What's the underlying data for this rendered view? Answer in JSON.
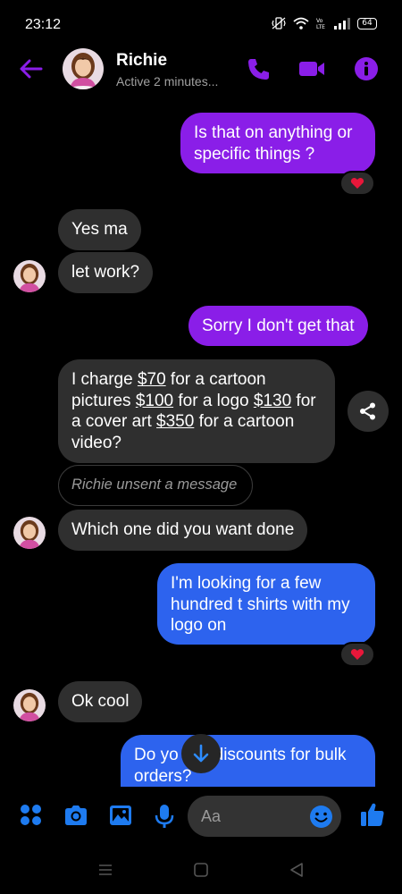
{
  "status_bar": {
    "time": "23:12",
    "battery": "64"
  },
  "header": {
    "name": "Richie",
    "status": "Active 2 minutes..."
  },
  "messages": [
    {
      "id": "m1",
      "side": "out",
      "text": "Is that on anything or specific things ?",
      "reaction": "heart"
    },
    {
      "id": "m2",
      "side": "in",
      "text": "Yes ma"
    },
    {
      "id": "m3",
      "side": "in",
      "text": "let work?"
    },
    {
      "id": "m4",
      "side": "out",
      "text": "Sorry I don't get that"
    },
    {
      "id": "m5",
      "side": "in",
      "segments": [
        "I charge ",
        "$70",
        " for a cartoon pictures ",
        "$100",
        " for a logo ",
        "$130",
        " for a cover art ",
        "$350",
        " for a cartoon video?"
      ]
    },
    {
      "id": "m6",
      "side": "in",
      "text": "Richie unsent a message"
    },
    {
      "id": "m7",
      "side": "in",
      "text": "Which one did you want done"
    },
    {
      "id": "m8",
      "side": "out",
      "text": "I'm looking for a few hundred t shirts with my logo on",
      "reaction": "heart"
    },
    {
      "id": "m9",
      "side": "in",
      "text": "Ok cool"
    },
    {
      "id": "m10",
      "side": "out",
      "text_before": "Do yo",
      "text_after": "discounts for bulk orders?"
    }
  ],
  "composer": {
    "placeholder": "Aa"
  },
  "icons": {
    "back": "arrow-left-icon",
    "call": "phone-icon",
    "video": "video-camera-icon",
    "info": "info-icon",
    "apps": "four-dots-icon",
    "camera": "camera-icon",
    "gallery": "image-icon",
    "mic": "microphone-icon",
    "emoji": "smiley-icon",
    "like": "thumbs-up-icon",
    "share": "share-icon",
    "scroll": "arrow-down-icon"
  },
  "colors": {
    "accent": "#8a1ee8",
    "outgoing_purple": "#8a1ee8",
    "outgoing_blue": "#2d63ee",
    "incoming": "#2f2f2f",
    "composer_icons": "#1e7bf0",
    "heart": "#e8173a"
  }
}
